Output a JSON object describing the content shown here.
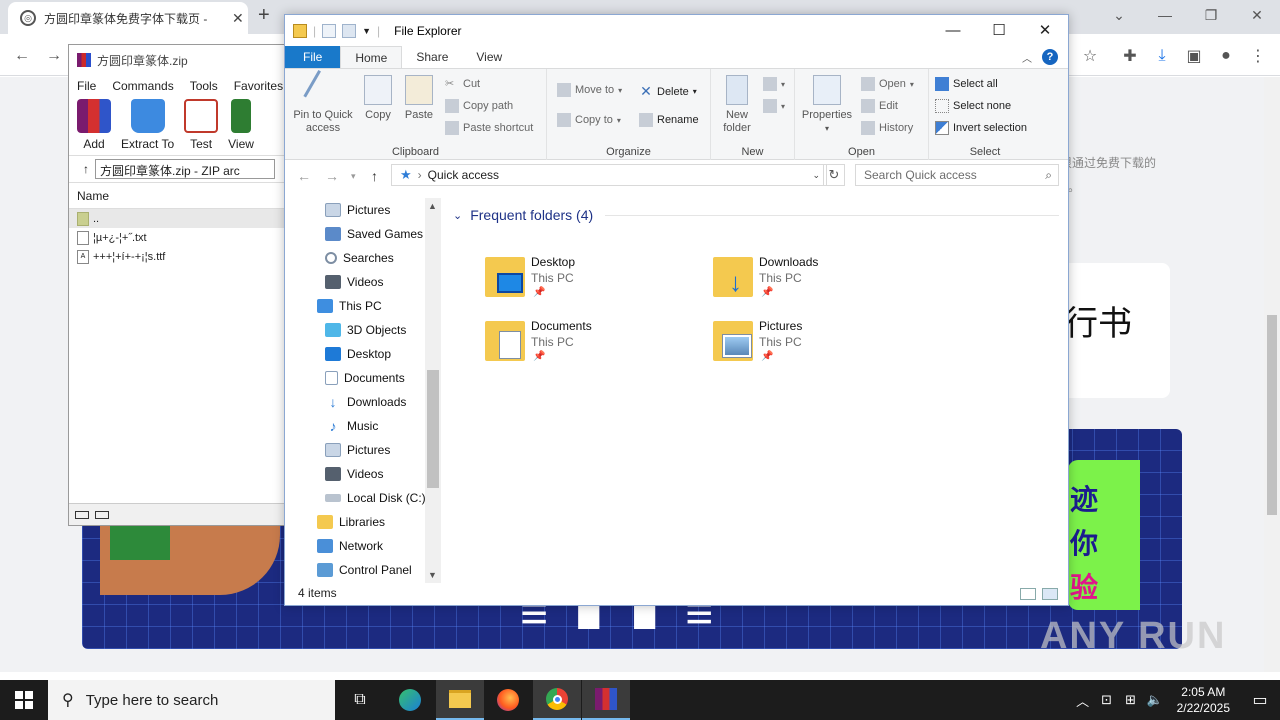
{
  "chrome": {
    "tab_title": "方圆印章篆体免费字体下载页 - ",
    "page_text_1": "很通过免费下载的",
    "page_text_2": "。",
    "calligraphy": "行书",
    "banner_chars": [
      "迹",
      "你",
      "验"
    ],
    "watermark": "ANY RUN"
  },
  "winrar": {
    "title": "方圆印章篆体.zip",
    "menu": [
      "File",
      "Commands",
      "Tools",
      "Favorites"
    ],
    "tools": [
      "Add",
      "Extract To",
      "Test",
      "View"
    ],
    "path": "方圆印章篆体.zip - ZIP arc",
    "column_name": "Name",
    "files": [
      "..",
      "¦µ+¿-¦+˝.txt",
      "+++¦+í+-+¡¦s.ttf"
    ]
  },
  "explorer": {
    "title": "File Explorer",
    "tabs": [
      "File",
      "Home",
      "Share",
      "View"
    ],
    "ribbon": {
      "clipboard": {
        "label": "Clipboard",
        "pin": "Pin to Quick access",
        "copy": "Copy",
        "paste": "Paste",
        "cut": "Cut",
        "copy_path": "Copy path",
        "paste_shortcut": "Paste shortcut"
      },
      "organize": {
        "label": "Organize",
        "move_to": "Move to",
        "copy_to": "Copy to",
        "delete": "Delete",
        "rename": "Rename"
      },
      "new": {
        "label": "New",
        "new_folder": "New folder"
      },
      "open": {
        "label": "Open",
        "properties": "Properties",
        "open": "Open",
        "edit": "Edit",
        "history": "History"
      },
      "select": {
        "label": "Select",
        "select_all": "Select all",
        "select_none": "Select none",
        "invert": "Invert selection"
      }
    },
    "address": "Quick access",
    "search_placeholder": "Search Quick access",
    "nav": [
      "Pictures",
      "Saved Games",
      "Searches",
      "Videos",
      "This PC",
      "3D Objects",
      "Desktop",
      "Documents",
      "Downloads",
      "Music",
      "Pictures",
      "Videos",
      "Local Disk (C:)",
      "Libraries",
      "Network",
      "Control Panel"
    ],
    "section_title": "Frequent folders (4)",
    "folders": [
      {
        "name": "Desktop",
        "location": "This PC"
      },
      {
        "name": "Downloads",
        "location": "This PC"
      },
      {
        "name": "Documents",
        "location": "This PC"
      },
      {
        "name": "Pictures",
        "location": "This PC"
      }
    ],
    "status": "4 items"
  },
  "taskbar": {
    "search_placeholder": "Type here to search",
    "time": "2:05 AM",
    "date": "2/22/2025"
  },
  "colors": {
    "accent": "#1979ca",
    "folder_yellow": "#f4c94f",
    "taskbar": "#1c1c1c"
  }
}
